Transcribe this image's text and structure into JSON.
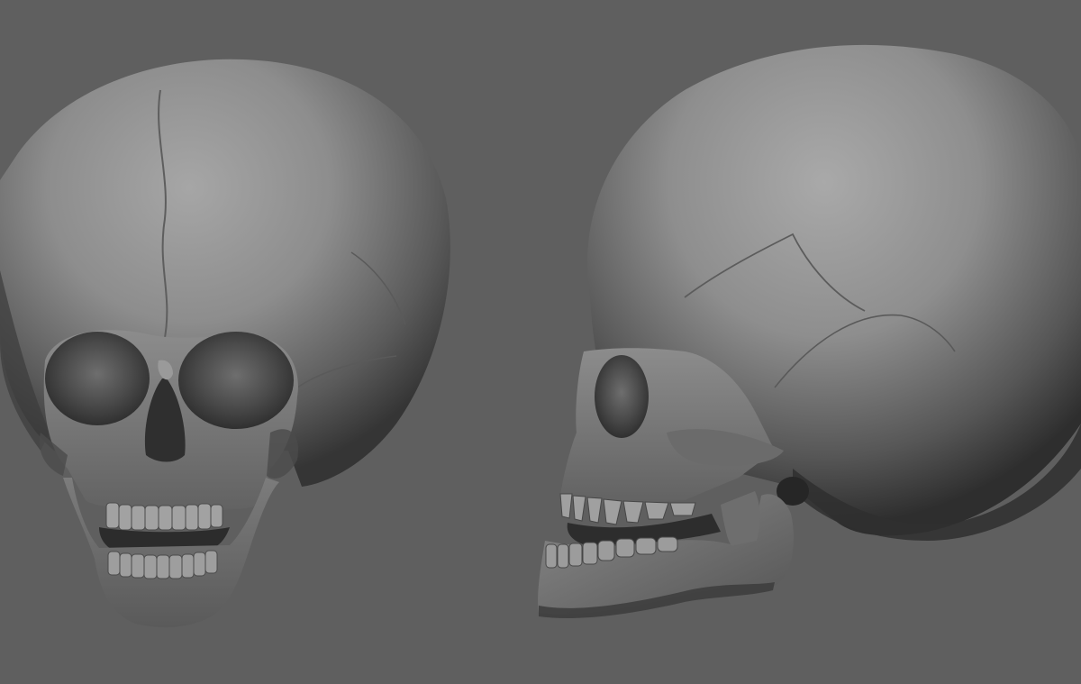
{
  "scene": {
    "background_color": "#5f5f5f",
    "material_color": "#8a8a8a",
    "objects": [
      {
        "name": "skull-front-view",
        "view": "front"
      },
      {
        "name": "skull-side-view",
        "view": "side"
      }
    ]
  }
}
